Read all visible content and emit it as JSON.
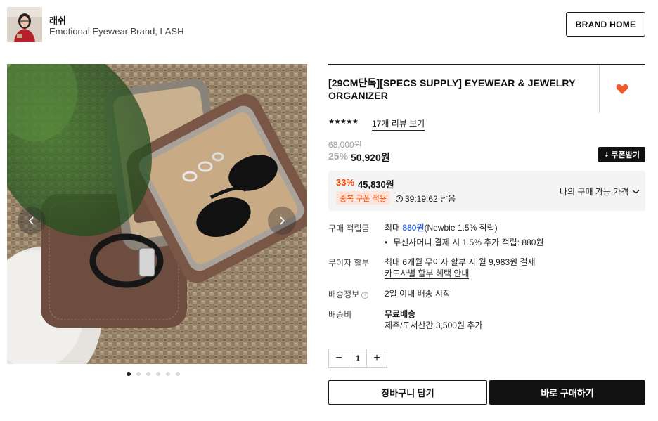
{
  "brand": {
    "name": "래쉬",
    "description": "Emotional Eyewear Brand, LASH",
    "home_button": "BRAND HOME"
  },
  "gallery": {
    "slide_count": 6,
    "active_index": 0,
    "prev_icon": "chevron-left-icon",
    "next_icon": "chevron-right-icon"
  },
  "product": {
    "title": "[29CM단독][SPECS SUPPLY] EYEWEAR & JEWELRY ORGANIZER",
    "rating_stars": "★★★★★",
    "review_link": "17개 리뷰 보기",
    "original_price": "68,000원",
    "discount_rate": "25%",
    "sale_price": "50,920원",
    "coupon_button": "쿠폰받기"
  },
  "my_price": {
    "discount_rate": "33%",
    "price": "45,830원",
    "coupon_badge": "중복 쿠폰 적용",
    "timer_text": "39:19:62 남음",
    "toggle_label": "나의 구매 가능 가격"
  },
  "info": {
    "points_label": "구매 적립금",
    "points_prefix": "최대 ",
    "points_amount": "880원",
    "points_suffix": "(Newbie 1.5% 적립)",
    "points_bullet": "무신사머니 결제 시 1.5% 추가 적립: 880원",
    "installment_label": "무이자 할부",
    "installment_text": "최대 6개월 무이자 할부 시 월 9,983원 결제",
    "installment_link": "카드사별 할부 혜택 안내",
    "shipping_label": "배송정보",
    "shipping_text": "2일 이내 배송 시작",
    "fee_label": "배송비",
    "fee_text": "무료배송",
    "fee_extra": "제주/도서산간 3,500원 추가"
  },
  "quantity": {
    "minus": "−",
    "value": "1",
    "plus": "+"
  },
  "actions": {
    "cart": "장바구니 담기",
    "buy": "바로 구매하기"
  },
  "colors": {
    "accent": "#ff4800",
    "link_blue": "#3a67d5",
    "heart": "#f05a28"
  }
}
